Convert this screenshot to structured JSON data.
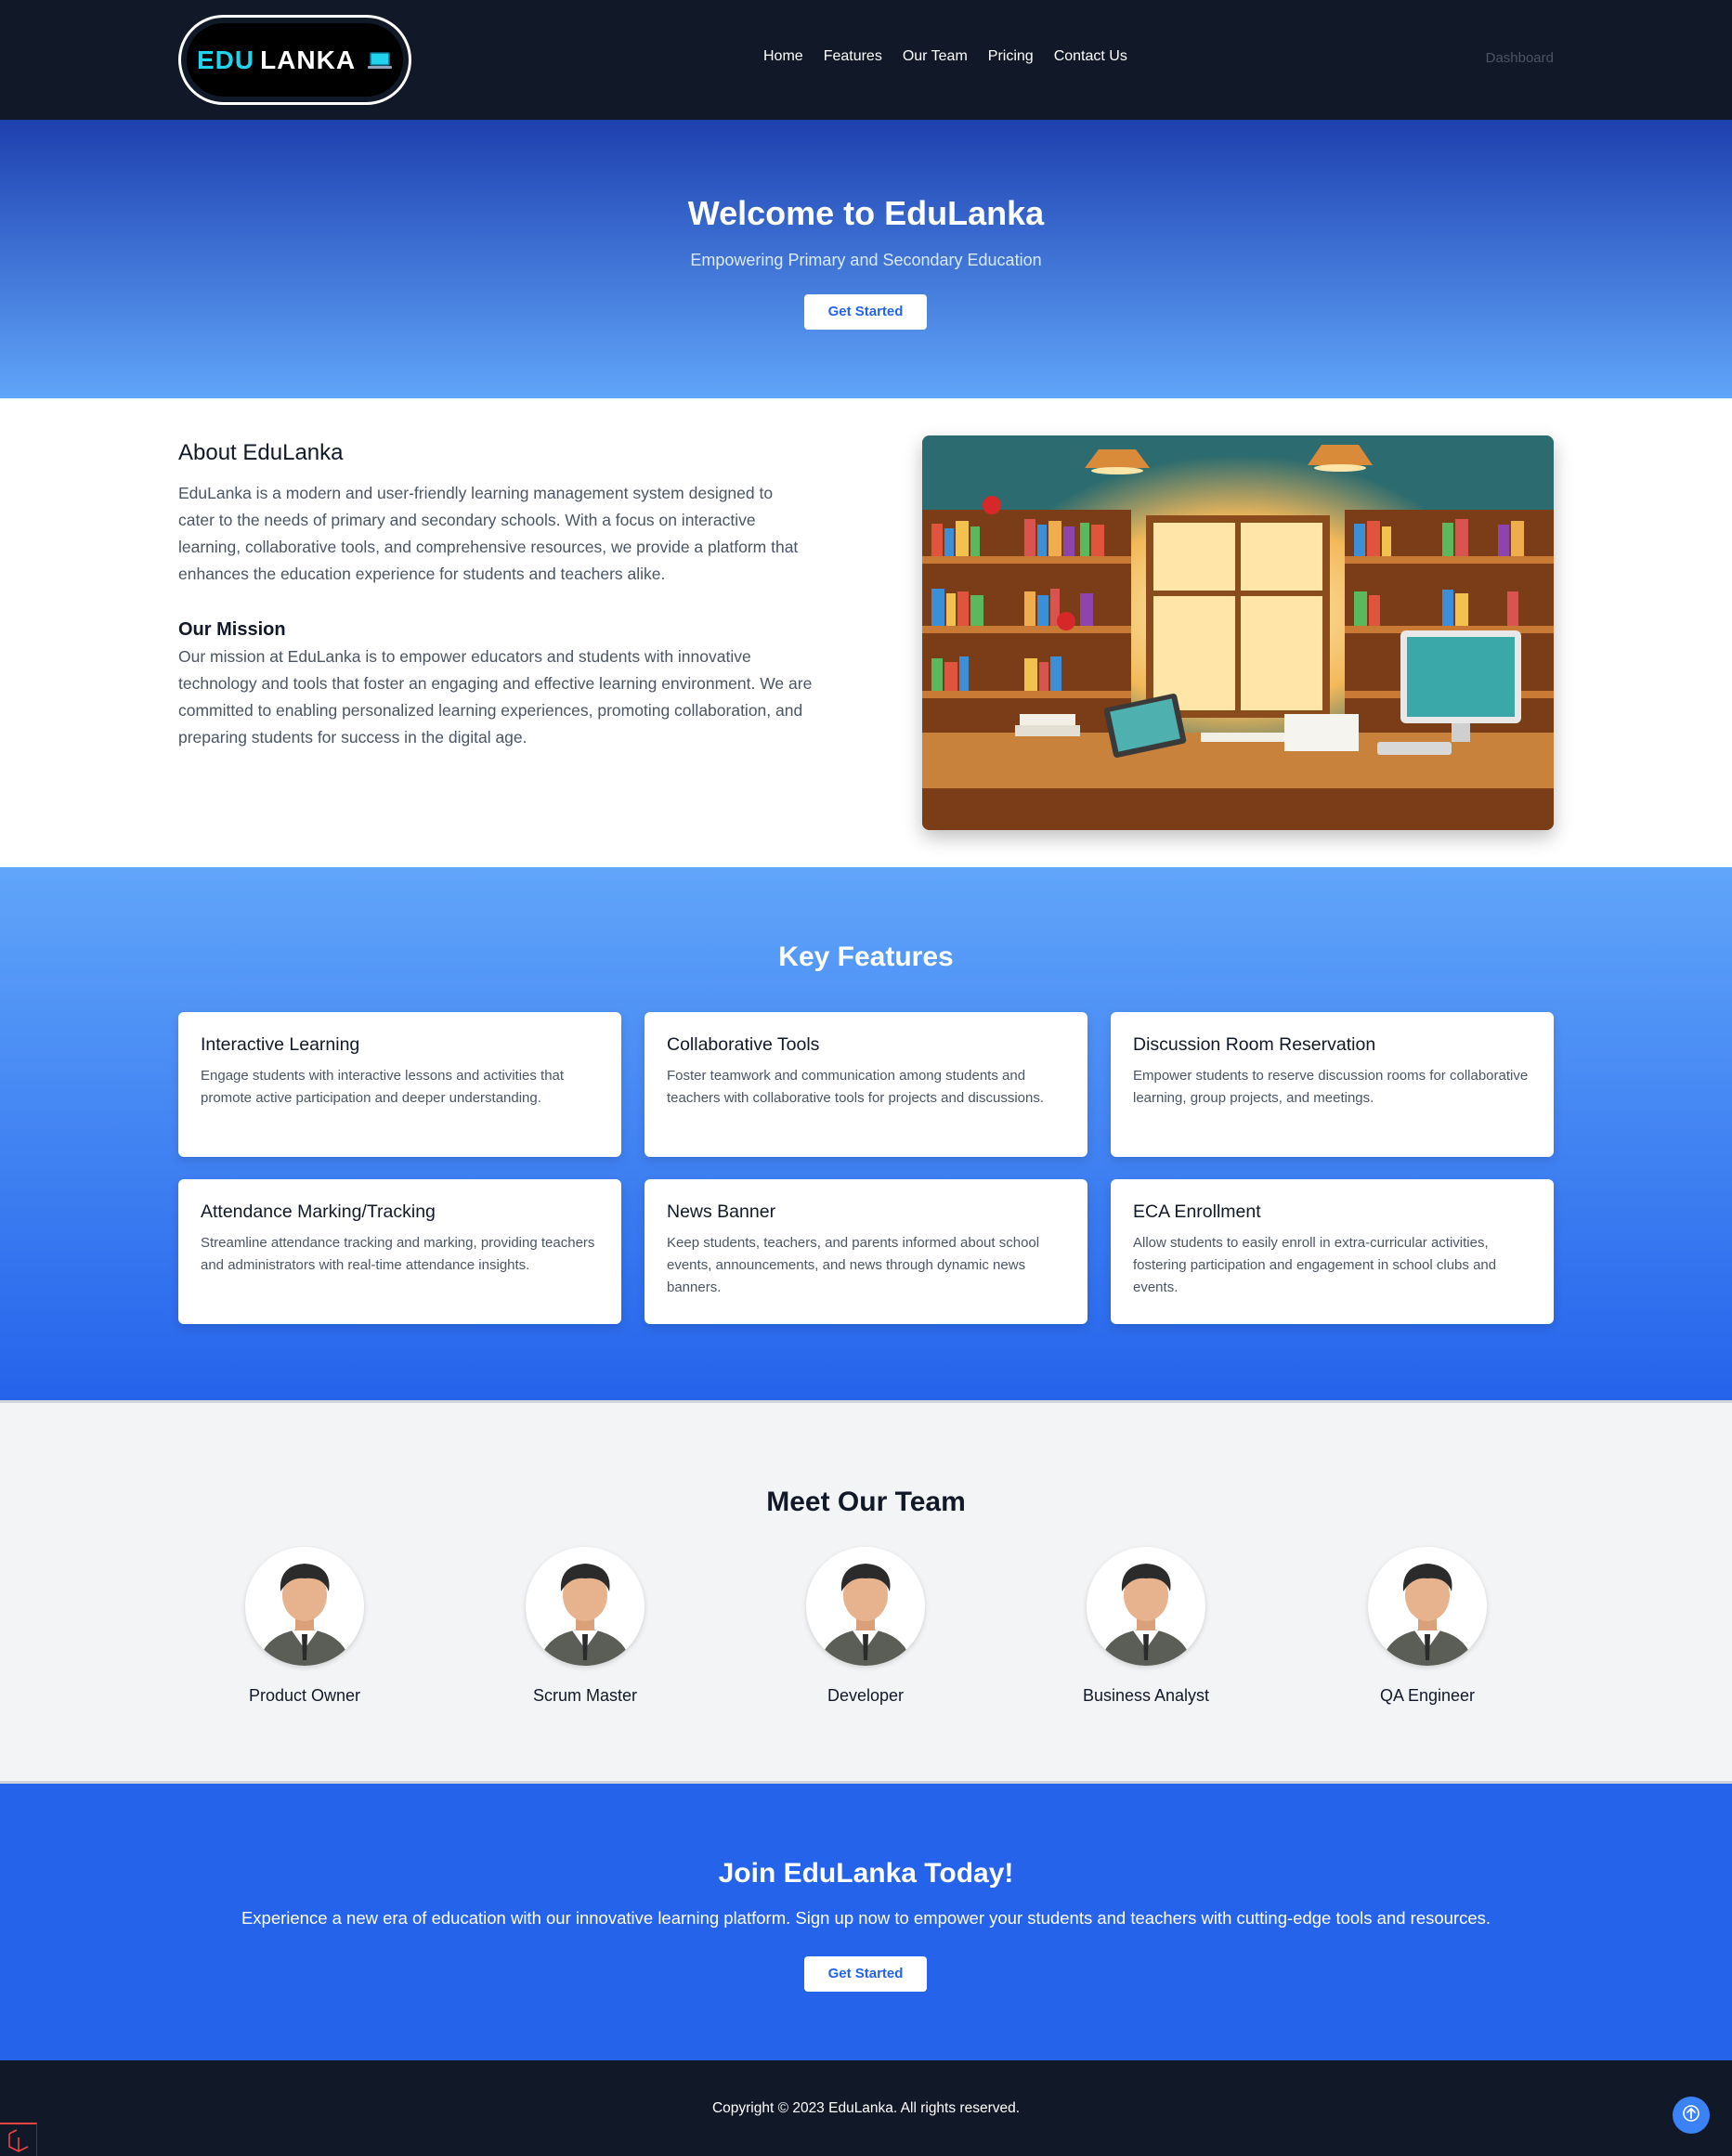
{
  "nav": {
    "logo": {
      "edu": "EDU",
      "lanka": "LANKA"
    },
    "links": [
      "Home",
      "Features",
      "Our Team",
      "Pricing",
      "Contact Us"
    ],
    "dashboard": "Dashboard"
  },
  "hero": {
    "title": "Welcome to EduLanka",
    "subtitle": "Empowering Primary and Secondary Education",
    "button": "Get Started"
  },
  "about": {
    "title": "About EduLanka",
    "text": "EduLanka is a modern and user-friendly learning management system designed to cater to the needs of primary and secondary schools. With a focus on interactive learning, collaborative tools, and comprehensive resources, we provide a platform that enhances the education experience for students and teachers alike.",
    "mission_title": "Our Mission",
    "mission_text": "Our mission at EduLanka is to empower educators and students with innovative technology and tools that foster an engaging and effective learning environment. We are committed to enabling personalized learning experiences, promoting collaboration, and preparing students for success in the digital age."
  },
  "features": {
    "title": "Key Features",
    "items": [
      {
        "title": "Interactive Learning",
        "text": "Engage students with interactive lessons and activities that promote active participation and deeper understanding."
      },
      {
        "title": "Collaborative Tools",
        "text": "Foster teamwork and communication among students and teachers with collaborative tools for projects and discussions."
      },
      {
        "title": "Discussion Room Reservation",
        "text": "Empower students to reserve discussion rooms for collaborative learning, group projects, and meetings."
      },
      {
        "title": "Attendance Marking/Tracking",
        "text": "Streamline attendance tracking and marking, providing teachers and administrators with real-time attendance insights."
      },
      {
        "title": "News Banner",
        "text": "Keep students, teachers, and parents informed about school events, announcements, and news through dynamic news banners."
      },
      {
        "title": "ECA Enrollment",
        "text": "Allow students to easily enroll in extra-curricular activities, fostering participation and engagement in school clubs and events."
      }
    ]
  },
  "team": {
    "title": "Meet Our Team",
    "members": [
      "Product Owner",
      "Scrum Master",
      "Developer",
      "Business Analyst",
      "QA Engineer"
    ]
  },
  "join": {
    "title": "Join EduLanka Today!",
    "text": "Experience a new era of education with our innovative learning platform. Sign up now to empower your students and teachers with cutting-edge tools and resources.",
    "button": "Get Started"
  },
  "footer": {
    "copyright": "Copyright © 2023 EduLanka. All rights reserved."
  },
  "icons": {
    "laptop": "laptop-icon",
    "scroll_top": "arrow-up-icon",
    "laravel": "laravel-icon"
  },
  "colors": {
    "nav_bg": "#111827",
    "primary": "#2563eb",
    "accent_cyan": "#22d3ee",
    "hero_top": "#1e40af",
    "hero_bottom": "#60a5fa"
  }
}
